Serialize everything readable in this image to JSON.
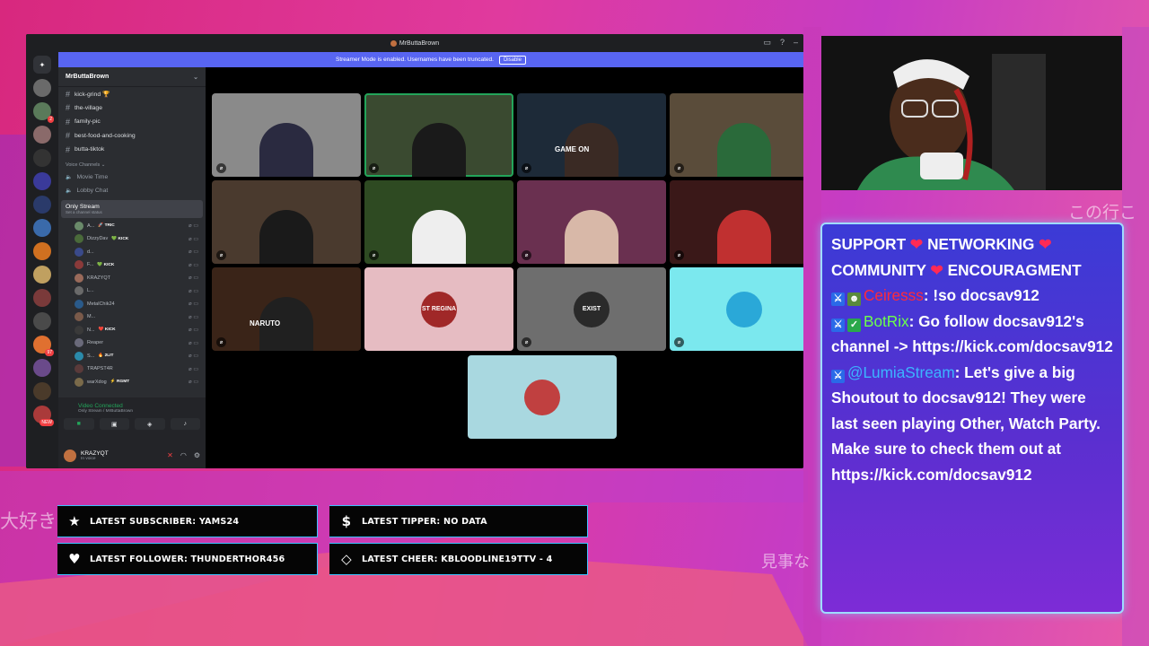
{
  "overlay": {
    "jp_left": "大好き",
    "jp_top_right": "この行こ",
    "jp_bottom_right": "見事な"
  },
  "discord": {
    "window_title": "MrButtaBrown",
    "streamer_banner": "Streamer Mode is enabled. Usernames have been truncated.",
    "streamer_disable": "Disable",
    "server_name": "MrButtaBrown",
    "server_badges": [
      "",
      "2",
      "",
      "",
      "",
      "",
      "",
      "",
      "",
      "",
      "",
      "97",
      "",
      "",
      "NEW"
    ],
    "text_channels": [
      "kick-grind 🏆",
      "the-village",
      "family-pic",
      "best-food-and-cooking",
      "butta-tiktok"
    ],
    "voice_category": "Voice Channels",
    "voice_channels": [
      "Movie Time",
      "Lobby Chat"
    ],
    "active_channel": {
      "name": "Only Stream",
      "status": "Set a channel status"
    },
    "voice_users": [
      {
        "name": "A...",
        "tag": "🚀 TRIC"
      },
      {
        "name": "DizzyDav",
        "tag": "💚 KICK"
      },
      {
        "name": "d...",
        "tag": ""
      },
      {
        "name": "F...",
        "tag": "💚 KICK"
      },
      {
        "name": "KRAZYQT",
        "tag": ""
      },
      {
        "name": "L...",
        "tag": ""
      },
      {
        "name": "MetalChik24",
        "tag": ""
      },
      {
        "name": "M...",
        "tag": ""
      },
      {
        "name": "N...",
        "tag": "❤️ KICK"
      },
      {
        "name": "Reaper",
        "tag": ""
      },
      {
        "name": "S...",
        "tag": "🔥 2LIT"
      },
      {
        "name": "TRAPST4R",
        "tag": ""
      },
      {
        "name": "warXdog",
        "tag": "⚡ RGMT"
      }
    ],
    "voice_status": "Video Connected",
    "voice_location": "Only Stream / MrButtaBrown",
    "user": {
      "name": "KRAZYQT",
      "status": "In voice"
    },
    "tiles": [
      {
        "label": "",
        "color": "#8a8a8a"
      },
      {
        "label": "",
        "color": "#3a4a30"
      },
      {
        "label": "GAME ON",
        "color": "#1d2a38"
      },
      {
        "label": "",
        "color": "#5a4c3a"
      },
      {
        "label": "",
        "color": "#4a3a2e"
      },
      {
        "label": "",
        "color": "#2e4a22"
      },
      {
        "label": "",
        "color": "#6a3050"
      },
      {
        "label": "",
        "color": "#3a1818"
      },
      {
        "label": "NARUTO",
        "color": "#3a2418"
      },
      {
        "label": "ST REGINA",
        "color": "#e6bcc2"
      },
      {
        "label": "EXIST",
        "color": "#6e6e6e"
      },
      {
        "label": "",
        "color": "#7be8ee"
      },
      {
        "label": "",
        "color": "#a9d8e0"
      }
    ]
  },
  "chat": {
    "header_line1_a": "SUPPORT",
    "header_line1_b": "NETWORKING",
    "header_line2_a": "COMMUNITY",
    "header_line2_b": "ENCOURAGMENT",
    "messages": [
      {
        "user": "Ceiresss",
        "user_color": "#ff2a3a",
        "text": ": !so docsav912"
      },
      {
        "user": "BotRix",
        "user_color": "#6cff4a",
        "text": ": Go follow docsav912's channel -> https://kick.com/docsav912"
      },
      {
        "user": "@LumiaStream",
        "user_color": "#3cb4ff",
        "text": ": Let's give a big Shoutout to docsav912! They were last seen playing Other, Watch Party. Make sure to check them out at https://kick.com/docsav912"
      }
    ]
  },
  "alerts": {
    "subscriber": "LATEST SUBSCRIBER: YAMS24",
    "tipper": "LATEST TIPPER: NO DATA",
    "follower": "LATEST FOLLOWER: THUNDERTHOR456",
    "cheer": "LATEST CHEER: KBLOODLINE19TTV - 4"
  },
  "colors": {
    "discord_blurple": "#5865f2",
    "chat_border": "#9fdcff",
    "alert_border": "#3cc2ff",
    "heart": "#ff2a55"
  }
}
